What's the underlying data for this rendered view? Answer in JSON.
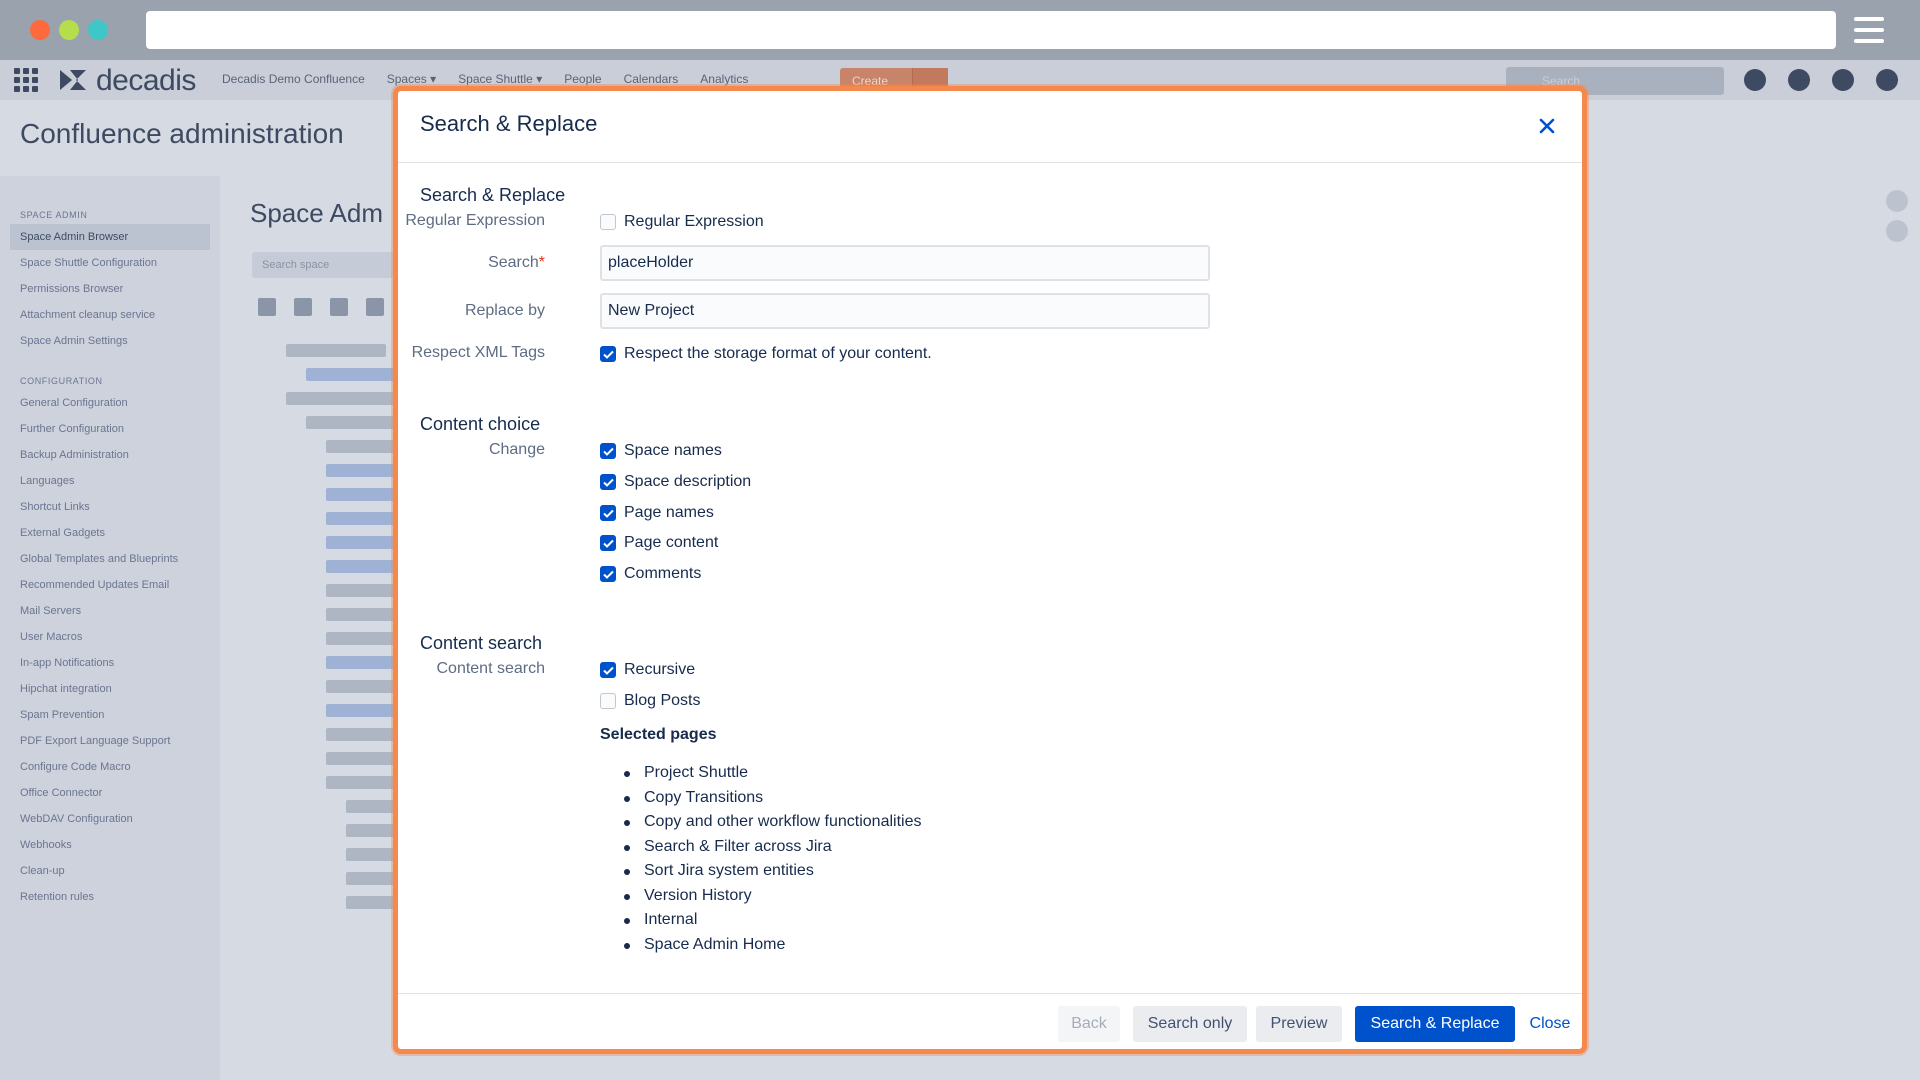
{
  "background": {
    "logo_text": "decadis",
    "nav": {
      "items": [
        "Decadis Demo Confluence",
        "Spaces ▾",
        "Space Shuttle ▾",
        "People",
        "Calendars",
        "Analytics"
      ],
      "create_label": "Create",
      "search_placeholder": "Search"
    },
    "page_title": "Confluence administration",
    "sidebar": {
      "space_admin_header": "SPACE ADMIN",
      "space_admin_items": [
        "Space Admin Browser",
        "Space Shuttle Configuration",
        "Permissions Browser",
        "Attachment cleanup service",
        "Space Admin Settings"
      ],
      "configuration_header": "CONFIGURATION",
      "configuration_items": [
        "General Configuration",
        "Further Configuration",
        "Backup Administration",
        "Languages",
        "Shortcut Links",
        "External Gadgets",
        "Global Templates and Blueprints",
        "Recommended Updates Email",
        "Mail Servers",
        "User Macros",
        "In-app Notifications",
        "Hipchat integration",
        "Spam Prevention",
        "PDF Export Language Support",
        "Configure Code Macro",
        "Office Connector",
        "WebDAV Configuration",
        "Webhooks",
        "Clean-up",
        "Retention rules"
      ]
    },
    "main": {
      "title": "Space Adm",
      "search_placeholder": "Search space"
    }
  },
  "modal": {
    "title": "Search & Replace",
    "sections": {
      "search_replace_title": "Search & Replace",
      "content_choice_title": "Content choice",
      "content_search_title": "Content search"
    },
    "fields": {
      "regex_label": "Regular Expression",
      "regex_checkbox_label": "Regular Expression",
      "search_label": "Search",
      "search_required": "*",
      "search_value": "placeHolder",
      "replace_label": "Replace by",
      "replace_value": "New Project",
      "xml_label": "Respect XML Tags",
      "xml_checkbox_label": "Respect the storage format of your content."
    },
    "change_label": "Change",
    "change_options": [
      {
        "label": "Space names",
        "checked": true
      },
      {
        "label": "Space description",
        "checked": true
      },
      {
        "label": "Page names",
        "checked": true
      },
      {
        "label": "Page content",
        "checked": true
      },
      {
        "label": "Comments",
        "checked": true
      }
    ],
    "content_search_label": "Content search",
    "content_search_options": [
      {
        "label": "Recursive",
        "checked": true
      },
      {
        "label": "Blog Posts",
        "checked": false
      }
    ],
    "selected_pages_heading": "Selected pages",
    "selected_pages": [
      "Project Shuttle",
      "Copy Transitions",
      "Copy and other workflow functionalities",
      "Search & Filter across Jira",
      "Sort Jira system entities",
      "Version History",
      "Internal",
      "Space Admin Home"
    ],
    "footer": {
      "back": "Back",
      "search_only": "Search only",
      "preview": "Preview",
      "search_replace": "Search & Replace",
      "close": "Close"
    }
  },
  "colors": {
    "accent": "#0052cc",
    "modal_border": "#f5884c",
    "required": "#de350b"
  }
}
